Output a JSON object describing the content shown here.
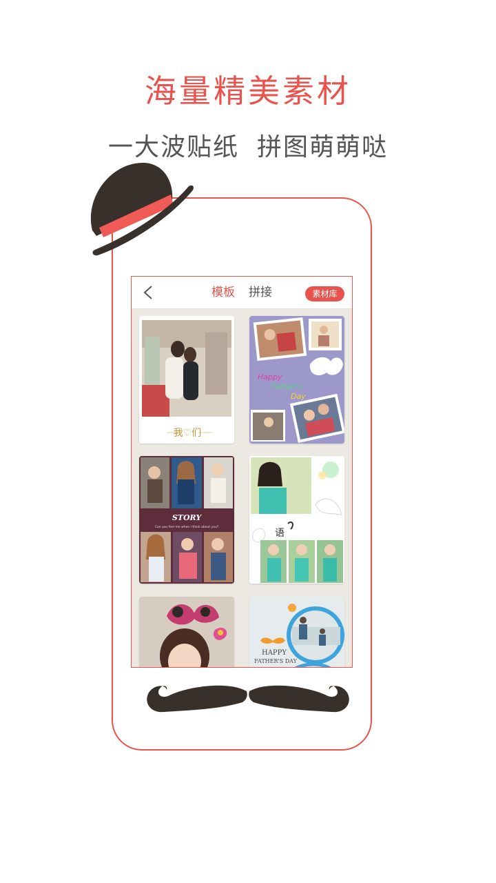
{
  "promo": {
    "headline": "海量精美素材",
    "subline_part1": "一大波贴纸",
    "subline_part2": "拼图萌萌哒",
    "headline_color": "#e8534e",
    "subline_color": "#555555"
  },
  "app": {
    "tabs": [
      {
        "label": "模板",
        "active": true
      },
      {
        "label": "拼接",
        "active": false
      }
    ],
    "material_button": "素材库",
    "accent_color": "#e8534e"
  },
  "templates": [
    {
      "caption": "我♡们"
    },
    {
      "caption_lines": [
        "Happy",
        "Father's",
        "Day"
      ]
    },
    {
      "caption": "STORY",
      "subcaption": "Can you feel me when I think about you?"
    },
    {
      "caption": "语"
    },
    {
      "caption": ""
    },
    {
      "caption_lines": [
        "HAPPY",
        "FATHER'S DAY"
      ]
    }
  ]
}
